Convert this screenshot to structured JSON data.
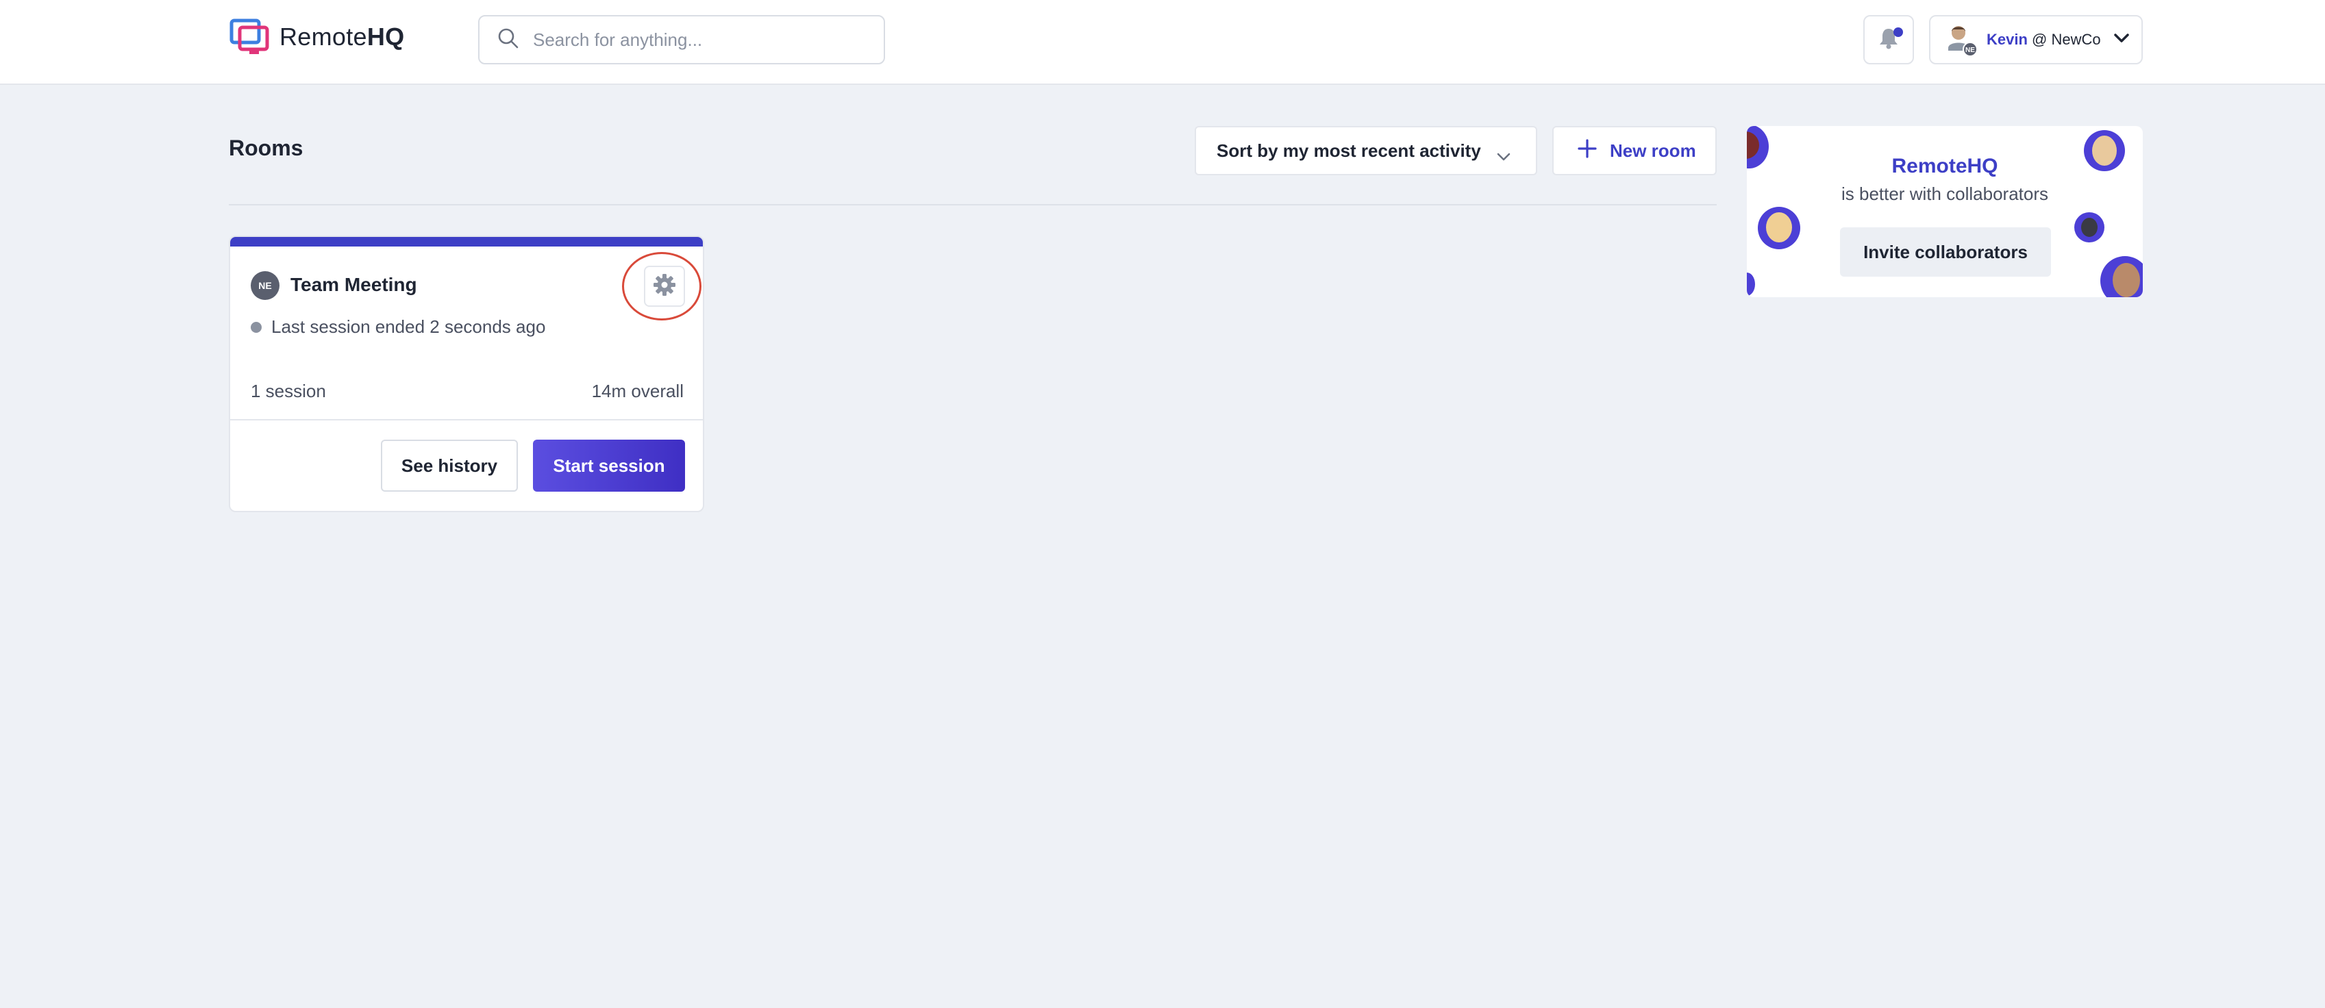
{
  "header": {
    "logo_text_regular": "Remote",
    "logo_text_bold": "HQ",
    "search_placeholder": "Search for anything...",
    "user_first_name": "Kevin",
    "user_org": "@ NewCo",
    "user_badge": "NE"
  },
  "rooms": {
    "title": "Rooms",
    "sort_label": "Sort by my most recent activity",
    "new_room_label": "New room"
  },
  "room_card": {
    "badge": "NE",
    "name": "Team Meeting",
    "status": "Last session ended 2 seconds ago",
    "sessions": "1 session",
    "overall": "14m overall",
    "see_history_label": "See history",
    "start_session_label": "Start session"
  },
  "promo": {
    "title": "RemoteHQ",
    "subtitle": "is better with collaborators",
    "invite_label": "Invite collaborators"
  },
  "colors": {
    "accent": "#3d3fc6",
    "background": "#eef1f6",
    "highlight_ring": "#d94a3a"
  }
}
